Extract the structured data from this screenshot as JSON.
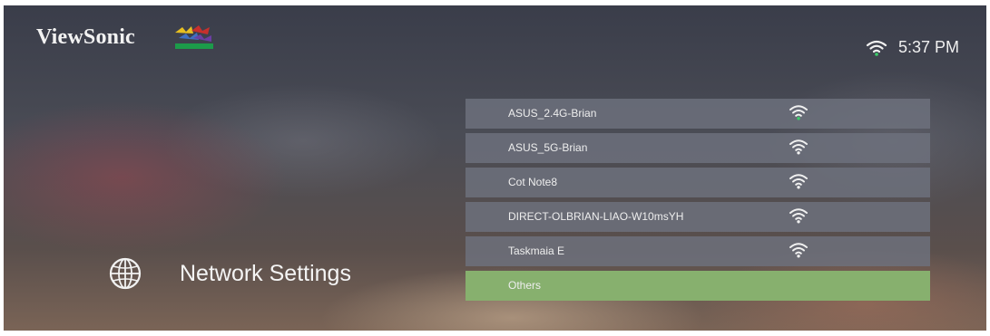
{
  "brand": {
    "name": "ViewSonic"
  },
  "status_bar": {
    "time": "5:37 PM",
    "wifi_icon": "wifi-icon",
    "wifi_color": "#3ccf6a"
  },
  "category": {
    "icon": "globe-icon",
    "title": "Network Settings"
  },
  "networks": [
    {
      "ssid": "ASUS_2.4G-Brian"
    },
    {
      "ssid": "ASUS_5G-Brian"
    },
    {
      "ssid": "Cot Note8"
    },
    {
      "ssid": "DIRECT-OLBRIAN-LIAO-W10msYH"
    },
    {
      "ssid": "Taskmaia E"
    }
  ],
  "others": {
    "label": "Others",
    "color": "#87b06e"
  }
}
